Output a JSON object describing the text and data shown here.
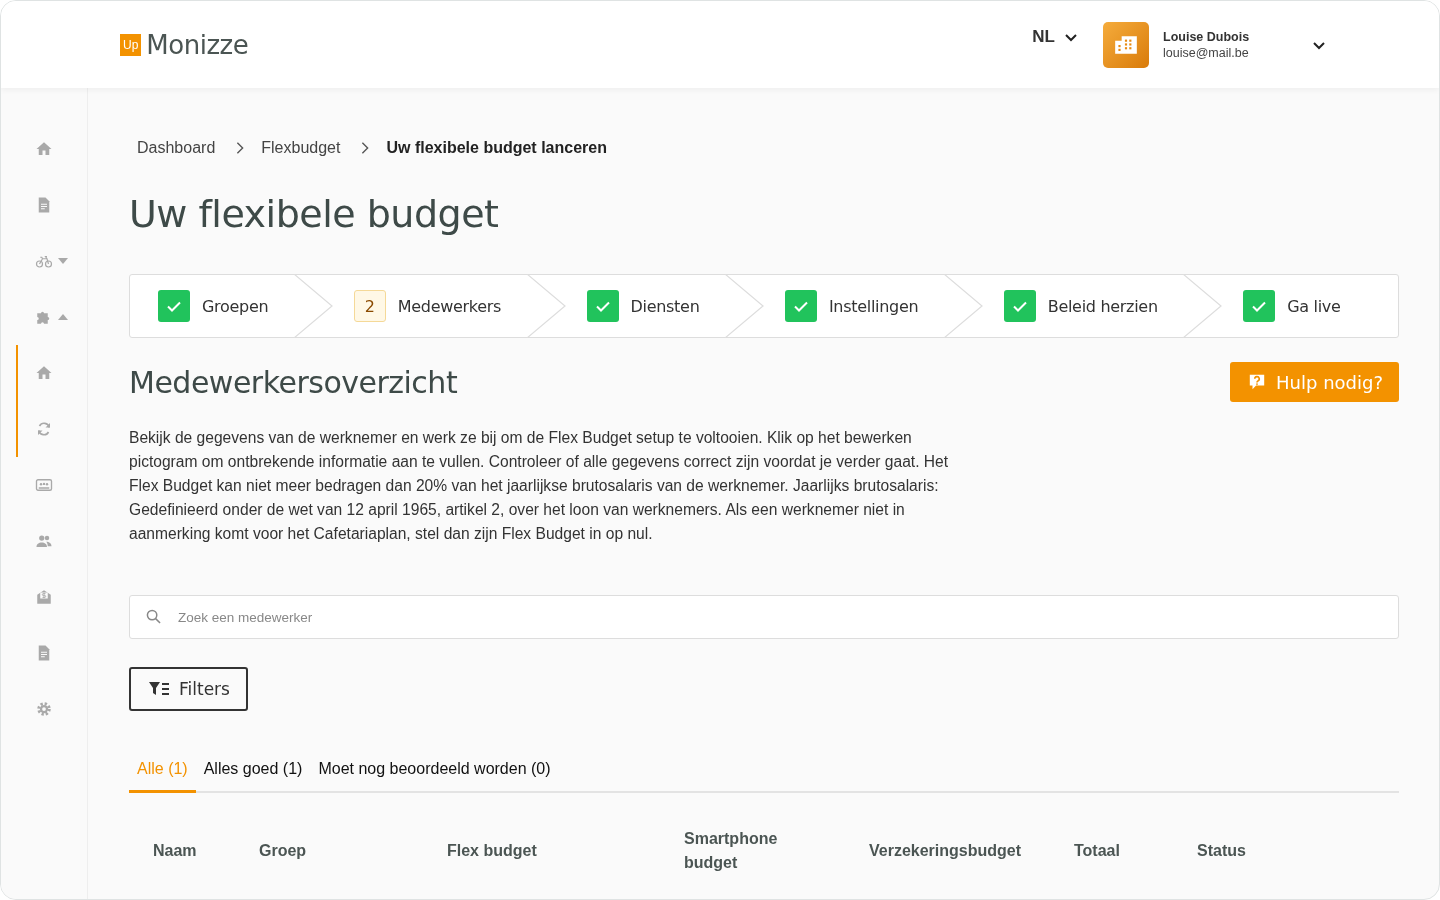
{
  "header": {
    "logo_badge": "Up",
    "logo_text": "Monizze",
    "language": "NL",
    "user": {
      "name": "Louise Dubois",
      "email": "louise@mail.be"
    }
  },
  "sidebar": {
    "items": [
      {
        "kind": "link"
      },
      {
        "kind": "link"
      },
      {
        "kind": "group",
        "expanded": false
      },
      {
        "kind": "group",
        "expanded": true,
        "children": [
          {
            "selected": true
          },
          {
            "selected": true
          }
        ]
      },
      {
        "kind": "link"
      },
      {
        "kind": "link"
      },
      {
        "kind": "link"
      },
      {
        "kind": "link"
      },
      {
        "kind": "link"
      }
    ]
  },
  "breadcrumb": [
    "Dashboard",
    "Flexbudget",
    "Uw flexibele budget lanceren"
  ],
  "title": "Uw flexibele budget",
  "steps": [
    {
      "label": "Groepen",
      "completed": true
    },
    {
      "label": "Medewerkers",
      "completed": false,
      "number": "2"
    },
    {
      "label": "Diensten",
      "completed": true
    },
    {
      "label": "Instellingen",
      "completed": true
    },
    {
      "label": "Beleid herzien",
      "completed": true
    },
    {
      "label": "Ga live",
      "completed": true
    }
  ],
  "section_title": "Medewerkersoverzicht",
  "help_button": "Hulp nodig?",
  "description": "Bekijk de gegevens van de werknemer en werk ze bij om de Flex Budget setup te voltooien. Klik op het bewerken pictogram om ontbrekende informatie aan te vullen. Controleer of alle gegevens correct zijn voordat je verder gaat. Het Flex Budget kan niet meer bedragen dan 20% van het jaarlijkse brutosalaris van de werknemer. Jaarlijks brutosalaris: Gedefinieerd onder de wet van 12 april 1965, artikel 2, over het loon van werknemers. Als een werknemer niet in aanmerking komt voor het Cafetariaplan, stel dan zijn Flex Budget in op nul.",
  "search": {
    "placeholder": "Zoek een medewerker"
  },
  "filters_button": "Filters",
  "tabs": [
    {
      "label": "Alle (1)",
      "selected": true
    },
    {
      "label": "Alles goed (1)",
      "selected": false
    },
    {
      "label": "Moet nog beoordeeld worden (0)",
      "selected": false
    }
  ],
  "table": {
    "columns": [
      "Naam",
      "Groep",
      "Flex budget",
      "Smartphone budget",
      "Verzekeringsbudget",
      "Totaal",
      "Status"
    ]
  }
}
